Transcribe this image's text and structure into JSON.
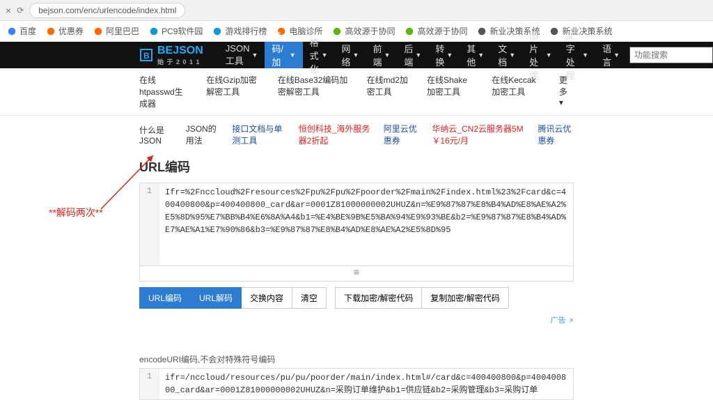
{
  "browser": {
    "url": "bejson.com/enc/urlencode/index.html"
  },
  "favorites": [
    {
      "label": "百度",
      "color": "#3385ff"
    },
    {
      "label": "优惠券",
      "color": "#ff6a00"
    },
    {
      "label": "阿里巴巴",
      "color": "#ff6a00"
    },
    {
      "label": "PC9软件园",
      "color": "#1296db"
    },
    {
      "label": "游戏排行榜",
      "color": "#1296db"
    },
    {
      "label": "电脑诊所",
      "color": "#ff6a00"
    },
    {
      "label": "高效源于协同",
      "color": "#5bb610"
    },
    {
      "label": "高效源于协同",
      "color": "#5bb610"
    },
    {
      "label": "新业决策系统",
      "color": "#555"
    },
    {
      "label": "新业决策系统",
      "color": "#555"
    }
  ],
  "brand": {
    "name": "BEJSON",
    "sub": "始 于 2 0 1 1"
  },
  "nav": [
    {
      "label": "JSON工具",
      "drop": true
    },
    {
      "label": "编码/加密",
      "drop": true,
      "active": true
    },
    {
      "label": "格式化",
      "drop": true
    },
    {
      "label": "网络",
      "drop": true
    },
    {
      "label": "前端",
      "drop": true
    },
    {
      "label": "后端",
      "drop": true
    },
    {
      "label": "转换",
      "drop": true
    },
    {
      "label": "其他",
      "drop": true
    },
    {
      "label": "文档",
      "drop": true
    },
    {
      "label": "图片处理",
      "drop": true
    },
    {
      "label": "文字处理",
      "drop": true
    },
    {
      "label": "语言",
      "drop": true
    }
  ],
  "search_placeholder": "功能搜索",
  "subnav": [
    "在线htpasswd生成器",
    "在线Gzip加密解密工具",
    "在线Base32编码加密解密工具",
    "在线md2加密工具",
    "在线Shake加密工具",
    "在线Keccak加密工具",
    "更多 ▾"
  ],
  "promo": [
    {
      "text": "什么是JSON",
      "color": "#333"
    },
    {
      "text": "JSON的用法",
      "color": "#333"
    },
    {
      "text": "接口文档与单测工具",
      "color": "#1e50a2"
    },
    {
      "text": "恒创科技_海外服务器2折起",
      "color": "#e02020"
    },
    {
      "text": "阿里云优惠券",
      "color": "#1e50a2"
    },
    {
      "text": "华纳云_CN2云服务器5M ￥16元/月",
      "color": "#e02020"
    },
    {
      "text": "腾讯云优惠券",
      "color": "#1e50a2"
    }
  ],
  "page_title": "URL编码",
  "input_code": "Ifr=%2Fnccloud%2Fresources%2Fpu%2Fpu%2Fpoorder%2Fmain%2Findex.html%23%2Fcard&c=400400800&p=400400800_card&ar=0001Z81000000002UHUZ&n=%E9%87%87%E8%B4%AD%E8%AE%A2%E5%8D%95%E7%BB%B4%E6%8A%A4&b1=%E4%BE%9B%E5%BA%94%E9%93%BE&b2=%E9%87%87%E8%B4%AD%E7%AE%A1%E7%90%86&b3=%E9%87%87%E8%B4%AD%E8%AE%A2%E5%8D%95",
  "buttons": {
    "encode": "URL编码",
    "decode": "URL解码",
    "swap": "交换内容",
    "clear": "清空",
    "download": "下载加密/解密代码",
    "copy": "复制加密/解密代码"
  },
  "ad_label": "广告",
  "output_note": "encodeURI编码,不会对特殊符号编码",
  "output_code": "ifr=/nccloud/resources/pu/pu/poorder/main/index.html#/card&c=400400800&p=400400800_card&ar=0001Z81000000002UHUZ&n=采购订单维护&b1=供应链&b2=采购管理&b3=采购订单",
  "annotation": "**解码两次**"
}
